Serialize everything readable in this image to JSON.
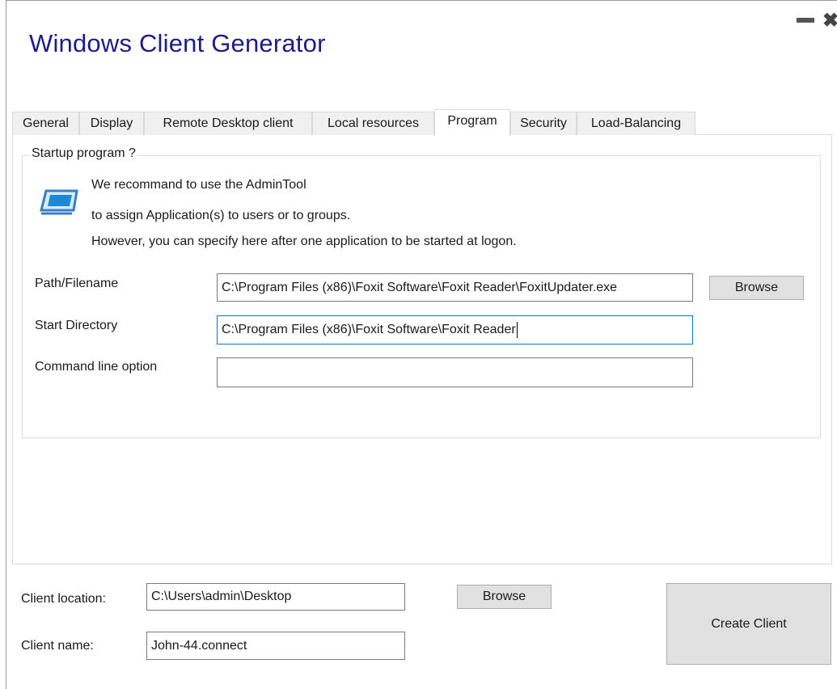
{
  "window": {
    "title": "Windows Client Generator",
    "minimize": "—",
    "close": "✖"
  },
  "tabs": [
    {
      "label": "General"
    },
    {
      "label": "Display"
    },
    {
      "label": "Remote Desktop client"
    },
    {
      "label": "Local resources"
    },
    {
      "label": "Program",
      "active": true
    },
    {
      "label": "Security"
    },
    {
      "label": "Load-Balancing"
    }
  ],
  "program": {
    "group_title": "Startup program ?",
    "info_line1": "We recommand to use the AdminTool",
    "info_line2": "to assign Application(s) to users or to groups.",
    "info_line3": "However, you can specify here after one application to be started at logon.",
    "icon": "admintool-icon",
    "path_label": "Path/Filename",
    "path_value": "C:\\Program Files (x86)\\Foxit Software\\Foxit Reader\\FoxitUpdater.exe",
    "browse_label": "Browse",
    "start_dir_label": "Start Directory",
    "start_dir_value": "C:\\Program Files (x86)\\Foxit Software\\Foxit Reader",
    "cmd_label": "Command line option",
    "cmd_value": ""
  },
  "footer": {
    "client_location_label": "Client location:",
    "client_location_value": "C:\\Users\\admin\\Desktop",
    "browse_label": "Browse",
    "client_name_label": "Client name:",
    "client_name_value": "John-44.connect",
    "create_label": "Create Client"
  },
  "colors": {
    "title": "#1c1c8c",
    "focus_border": "#0078d7",
    "button_bg": "#e1e1e1"
  }
}
